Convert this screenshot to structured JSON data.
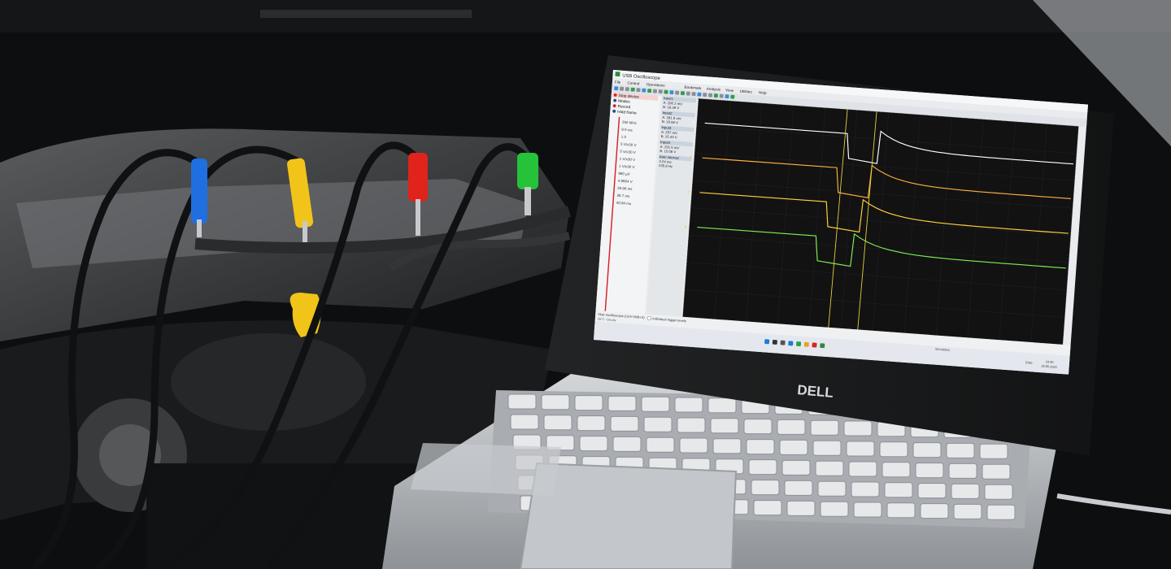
{
  "window": {
    "title": "USB Oscilloscope",
    "menus": [
      "File",
      "Control",
      "Operations",
      "Bookmark",
      "Analysis",
      "View",
      "Utilities",
      "Help"
    ]
  },
  "sidebar": {
    "items": [
      {
        "label": "Stop device"
      },
      {
        "label": "Modes"
      },
      {
        "label": "Record"
      },
      {
        "label": "Hold frame"
      }
    ],
    "readouts": [
      "250 MHz",
      "9.5 ms",
      "1.5",
      "5 V/x30 V",
      "5 V/x30 V",
      "1 V/x30 V",
      "1 V/x30 V",
      "960 µV",
      "4.9664 V",
      "28.96 ms",
      "36.7 ms",
      "40.94 ms"
    ]
  },
  "measurements": {
    "groups": [
      {
        "title": "Input1",
        "lines": [
          "A: 290.2 mV",
          "B: 18.49 V"
        ]
      },
      {
        "title": "Input2",
        "lines": [
          "A: 281.9 mV",
          "B: 16.58 V"
        ]
      },
      {
        "title": "Input3",
        "lines": [
          "A: 297 mV",
          "B: 15.43 V"
        ]
      },
      {
        "title": "Input4",
        "lines": [
          "A: 291.5 mV",
          "B: 15.08 V"
        ]
      },
      {
        "title": "Auto interval",
        "lines": [
          "4.24 ms",
          "235.8 Hz"
        ]
      }
    ]
  },
  "channels": [
    {
      "label": "1",
      "color": "#ffffff"
    },
    {
      "label": "2",
      "color": "#ffb040"
    },
    {
      "label": "3",
      "color": "#ffd23a"
    },
    {
      "label": "4",
      "color": "#7cf050"
    }
  ],
  "status": {
    "hint": "Stop oscilloscope (Ctrl+Shift+S)",
    "checkbox": "Individual trigger levels",
    "weather_temp": "25°C",
    "weather_desc": "Cloudy",
    "mode": "Simulation",
    "lang": "ENG",
    "time": "10:45",
    "date": "20.05.2022"
  },
  "laptop": {
    "brand": "DELL"
  },
  "colors": {
    "probe_blue": "#1f6fe0",
    "probe_yellow": "#f2c318",
    "probe_red": "#e0231b",
    "probe_green": "#25c23a",
    "screen_bg": "#121213",
    "laptop_silver": "#b9bdc2"
  }
}
